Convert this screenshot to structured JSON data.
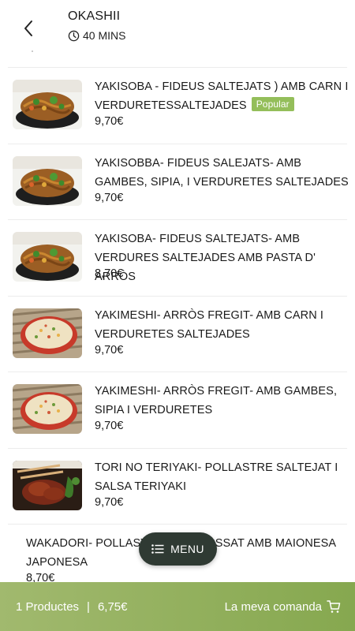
{
  "header": {
    "store_name": "OKASHII",
    "eta": "40 MINS"
  },
  "products": [
    {
      "title": "YAKISOBA - FIDEUS SALTEJATS ) AMB CARN I VERDURETESSALTEJADES",
      "badge": "Popular",
      "price": "9,70€",
      "image": "yakisoba-noodles"
    },
    {
      "title": "YAKISOBBA- FIDEUS SALEJATS- AMB GAMBES, SIPIA, I VERDURETES SALTEJADES",
      "price": "9,70€",
      "image": "yakisoba-noodles"
    },
    {
      "title": "YAKISOBA- FIDEUS SALTEJATS- AMB VERDURES SALTEJADES AMB PASTA D' ARRÒS",
      "price": "8,70€",
      "image": "yakisoba-noodles"
    },
    {
      "title": "YAKIMESHI- ARRÒS FREGIT- AMB CARN I VERDURETES SALTEJADES",
      "price": "9,70€",
      "image": "fried-rice"
    },
    {
      "title": "YAKIMESHI- ARRÒS FREGIT- AMB GAMBES, SIPIA I VERDURETES",
      "price": "9,70€",
      "image": "fried-rice"
    },
    {
      "title": "TORI NO TERIYAKI- POLLASTRE SALTEJAT I SALSA TERIYAKI",
      "price": "9,70€",
      "image": "teriyaki-chicken"
    },
    {
      "title": "WAKADORI- POLLASTRE ARREBOSSAT AMB MAIONESA JAPONESA",
      "price": "8,70€"
    }
  ],
  "menu_button": {
    "label": "MENU",
    "icon": "list-icon"
  },
  "cart": {
    "count_label": "1 Productes",
    "separator": "|",
    "total": "6,75€",
    "cta": "La meva comanda",
    "icon": "cart-icon"
  },
  "colors": {
    "accent_green": "#94be5a",
    "cart_bar_left": "#a1b96e",
    "cart_bar_right": "#86a84f",
    "menu_button_bg": "#2f3a33"
  }
}
